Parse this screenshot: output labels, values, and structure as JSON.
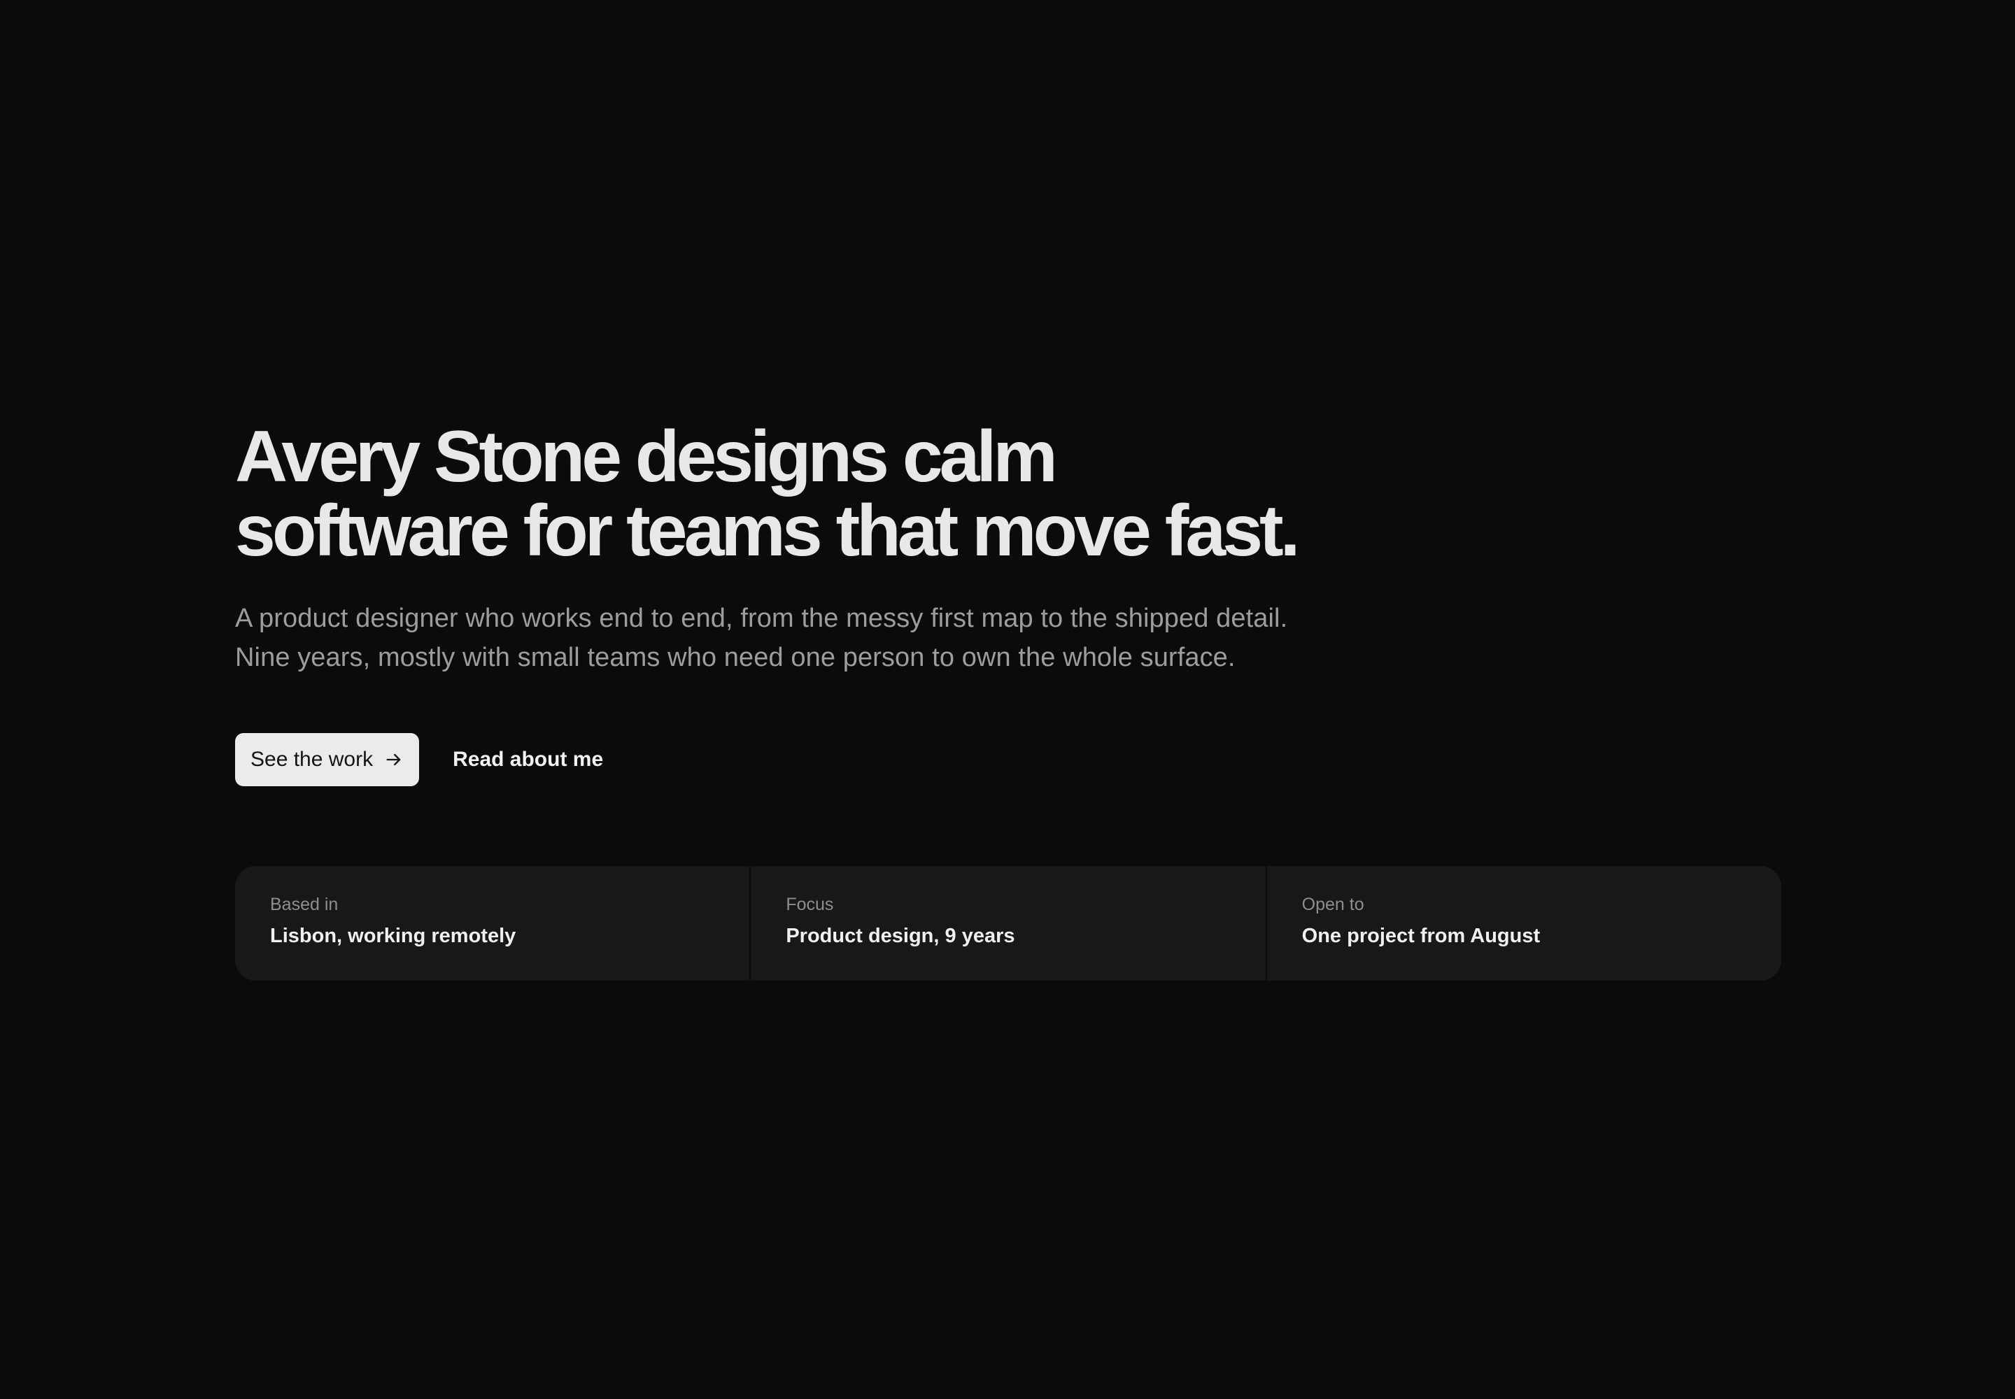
{
  "hero": {
    "headline_line1": "Avery Stone designs calm",
    "headline_line2": "software for teams that move fast.",
    "lede_line1": "A product designer who works end to end, from the messy first map to the shipped detail.",
    "lede_line2": "Nine years, mostly with small teams who need one person to own the whole surface."
  },
  "actions": {
    "primary_label": "See the work",
    "primary_icon": "arrow-right-icon",
    "secondary_label": "Read about me"
  },
  "facts": [
    {
      "label": "Based in",
      "value": "Lisbon, working remotely"
    },
    {
      "label": "Focus",
      "value": "Product design, 9 years"
    },
    {
      "label": "Open to",
      "value": "One project from August"
    }
  ],
  "colors": {
    "background": "#0b0b0b",
    "card": "#181818",
    "primary_button": "#ebebeb",
    "muted_text": "#9d9d9d"
  }
}
